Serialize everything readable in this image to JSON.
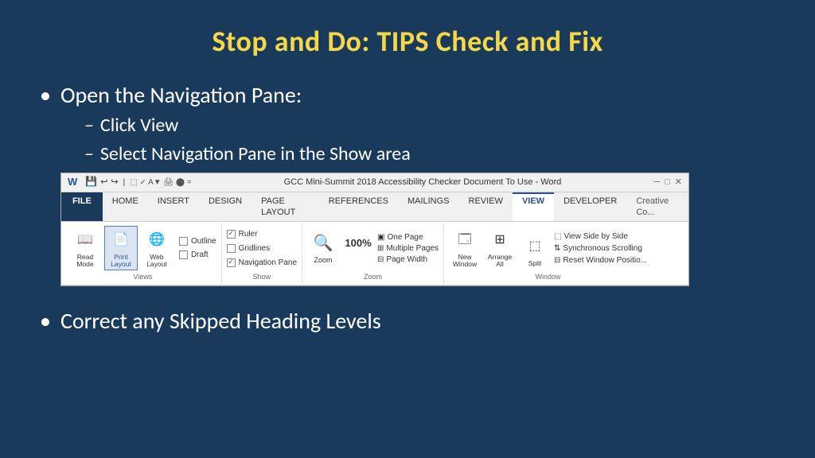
{
  "slide": {
    "title": "Stop and Do: TIPS Check and Fix",
    "bullet1": {
      "text": "Open the Navigation Pane:",
      "sub1": "Click View",
      "sub2": "Select Navigation Pane in the Show area"
    },
    "bullet2": {
      "text": "Correct any Skipped Heading Levels"
    },
    "ribbon": {
      "title_bar": "GCC Mini-Summit 2018 Accessibility Checker Document To Use - Word",
      "tabs": [
        "FILE",
        "HOME",
        "INSERT",
        "DESIGN",
        "PAGE LAYOUT",
        "REFERENCES",
        "MAILINGS",
        "REVIEW",
        "VIEW",
        "DEVELOPER",
        "Creative Co..."
      ],
      "active_tab": "VIEW",
      "groups": {
        "views": {
          "label": "Views",
          "read_mode": "Read Mode",
          "print_layout": "Print Layout",
          "web_layout": "Web Layout",
          "outline": "Outline",
          "draft": "Draft"
        },
        "show": {
          "label": "Show",
          "ruler": "Ruler",
          "gridlines": "Gridlines",
          "nav_pane": "Navigation Pane"
        },
        "zoom": {
          "label": "Zoom",
          "zoom_btn": "Zoom",
          "percent": "100%",
          "one_page": "One Page",
          "multiple": "Multiple Pages",
          "page_width": "Page Width"
        },
        "window": {
          "label": "Window",
          "new_window": "New Window",
          "arrange": "Arrange All",
          "split": "Split",
          "view_side": "View Side by Side",
          "sync_scroll": "Synchronous Scrolling",
          "reset_pos": "Reset Window Position"
        }
      }
    }
  },
  "colors": {
    "bg": "#1a3a5c",
    "title": "#f5d848",
    "text": "#ffffff",
    "active_tab_color": "#2b5394"
  }
}
